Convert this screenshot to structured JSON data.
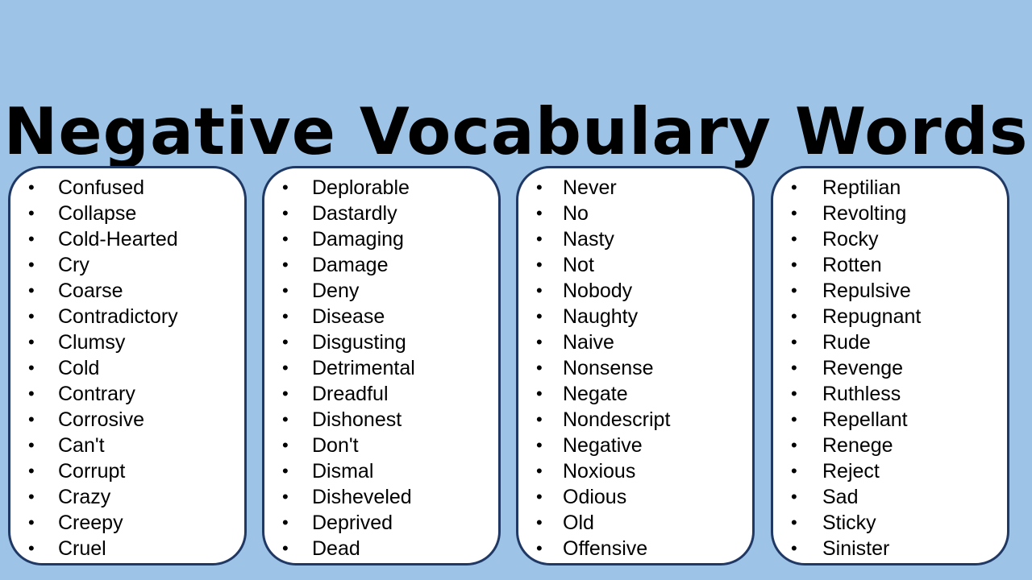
{
  "title": "Negative Vocabulary Words",
  "colors": {
    "background": "#9dc3e6",
    "card_background": "#ffffff",
    "card_border": "#203864",
    "text": "#000000"
  },
  "bullet_icon": "•",
  "columns": [
    {
      "words": [
        "Confused",
        "Collapse",
        "Cold-Hearted",
        "Cry",
        "Coarse",
        "Contradictory",
        "Clumsy",
        "Cold",
        "Contrary",
        "Corrosive",
        "Can't",
        "Corrupt",
        "Crazy",
        "Creepy",
        "Cruel"
      ]
    },
    {
      "words": [
        "Deplorable",
        "Dastardly",
        "Damaging",
        "Damage",
        "Deny",
        "Disease",
        "Disgusting",
        "Detrimental",
        "Dreadful",
        "Dishonest",
        "Don't",
        "Dismal",
        "Disheveled",
        "Deprived",
        "Dead"
      ]
    },
    {
      "words": [
        "Never",
        "No",
        "Nasty",
        "Not",
        "Nobody",
        "Naughty",
        "Naive",
        "Nonsense",
        "Negate",
        "Nondescript",
        "Negative",
        "Noxious",
        "Odious",
        "Old",
        "Offensive"
      ]
    },
    {
      "words": [
        "Reptilian",
        "Revolting",
        "Rocky",
        "Rotten",
        "Repulsive",
        "Repugnant",
        "Rude",
        "Revenge",
        "Ruthless",
        "Repellant",
        "Renege",
        "Reject",
        "Sad",
        "Sticky",
        "Sinister"
      ]
    }
  ]
}
